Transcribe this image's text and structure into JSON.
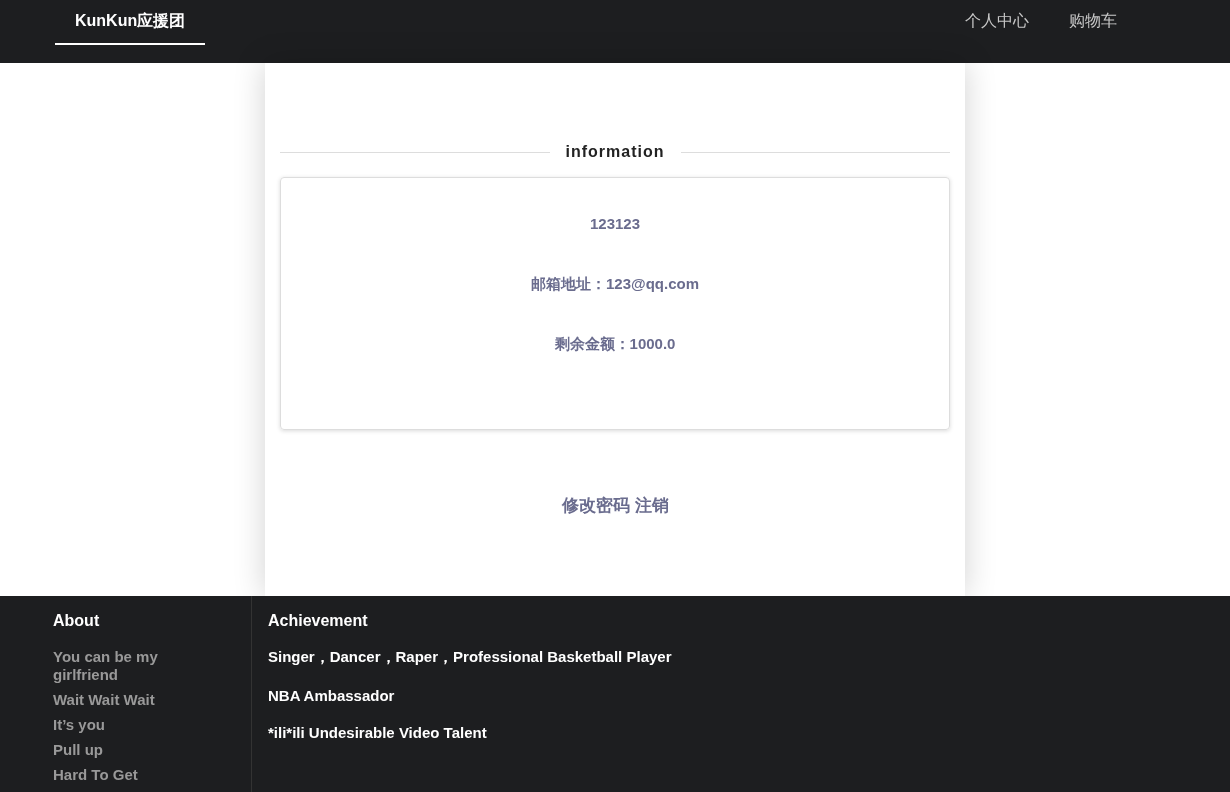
{
  "nav": {
    "brand": {
      "label": "KunKun应援团",
      "selected": true
    },
    "links": [
      {
        "label": "个人中心",
        "selected": false
      },
      {
        "label": "购物车",
        "selected": false
      }
    ]
  },
  "info": {
    "heading": "information",
    "lines": [
      "123123",
      "邮箱地址：123@qq.com",
      "剩余金额：1000.0"
    ],
    "actions": [
      "修改密码",
      "注销"
    ]
  },
  "footer": {
    "about": {
      "title": "About",
      "items": [
        "You can be my girlfriend",
        "Wait Wait Wait",
        "It’s you",
        "Pull up",
        "Hard To Get"
      ]
    },
    "achievement": {
      "title": "Achievement",
      "items": [
        "Singer，Dancer，Raper，Professional Basketball Player",
        "NBA Ambassador",
        "*ili*ili Undesirable Video Talent"
      ]
    }
  }
}
